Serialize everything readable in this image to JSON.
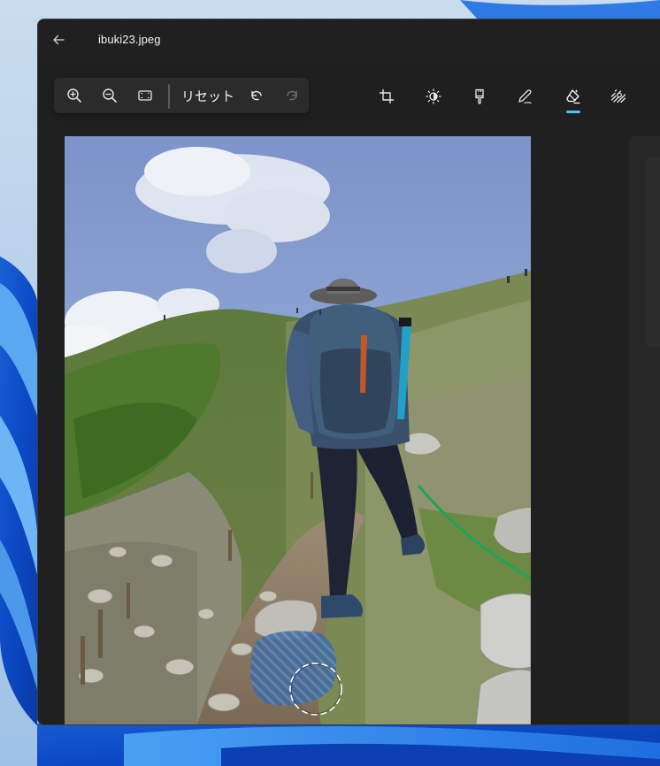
{
  "window": {
    "title": "ibuki23.jpeg"
  },
  "toolbar": {
    "view_group": [
      {
        "name": "zoom-in-button",
        "icon": "zoom-in-icon"
      },
      {
        "name": "zoom-out-button",
        "icon": "zoom-out-icon"
      },
      {
        "name": "fit-to-window-button",
        "icon": "fit-to-window-icon"
      }
    ],
    "reset_label": "リセット",
    "undo_icon": "undo-icon",
    "redo_icon": "redo-icon",
    "tools": [
      {
        "name": "crop-tool",
        "icon": "crop-icon",
        "active": false
      },
      {
        "name": "adjustment-tool",
        "icon": "brightness-icon",
        "active": false
      },
      {
        "name": "filter-tool",
        "icon": "filter-brush-icon",
        "active": false
      },
      {
        "name": "markup-tool",
        "icon": "pen-icon",
        "active": false
      },
      {
        "name": "erase-tool",
        "icon": "eraser-icon",
        "active": true
      },
      {
        "name": "background-tool",
        "icon": "background-blur-icon",
        "active": false
      }
    ]
  },
  "colors": {
    "accent": "#4cc2ff",
    "window_bg": "#202020",
    "toolbar_group_bg": "#2b2b2b"
  }
}
